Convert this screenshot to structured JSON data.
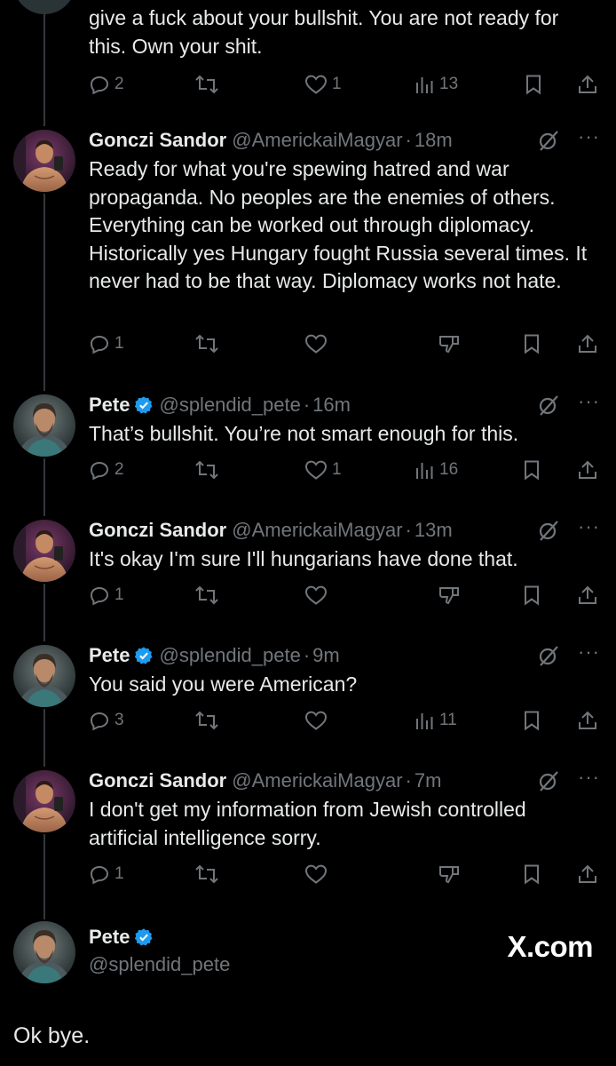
{
  "colors": {
    "background": "#000000",
    "text_primary": "#e7e9ea",
    "text_secondary": "#71767b",
    "verified_blue": "#1d9bf0",
    "thread_line": "#333639"
  },
  "top_partial": {
    "text": "give a fuck about your bullshit. You are not ready for this. Own your shit.",
    "replies": "2",
    "likes": "1",
    "views": "13"
  },
  "tweets": [
    {
      "name": "Gonczi Sandor",
      "verified": false,
      "handle": "@AmerickaiMagyar",
      "dot": "·",
      "time": "18m",
      "text": "Ready for what you're spewing hatred and war propaganda. No peoples are the enemies of others. Everything can be worked out through diplomacy. Historically yes Hungary fought Russia several times. It never had to be that way. Diplomacy works not hate.",
      "replies": "1",
      "likes": "",
      "views": "",
      "downvote": true
    },
    {
      "name": "Pete",
      "verified": true,
      "handle": "@splendid_pete",
      "dot": "·",
      "time": "16m",
      "text": "That’s bullshit. You’re not smart enough for this.",
      "replies": "2",
      "likes": "1",
      "views": "16",
      "downvote": false
    },
    {
      "name": "Gonczi Sandor",
      "verified": false,
      "handle": "@AmerickaiMagyar",
      "dot": "·",
      "time": "13m",
      "text": "It's okay I'm sure I'll hungarians have done that.",
      "replies": "1",
      "likes": "",
      "views": "",
      "downvote": true
    },
    {
      "name": "Pete",
      "verified": true,
      "handle": "@splendid_pete",
      "dot": "·",
      "time": "9m",
      "text": "You said you were American?",
      "replies": "3",
      "likes": "",
      "views": "11",
      "downvote": false
    },
    {
      "name": "Gonczi Sandor",
      "verified": false,
      "handle": "@AmerickaiMagyar",
      "dot": "·",
      "time": "7m",
      "text": "I don't get my information from Jewish controlled artificial intelligence sorry.",
      "replies": "1",
      "likes": "",
      "views": "",
      "downvote": true
    }
  ],
  "final_tweet": {
    "name": "Pete",
    "handle": "@splendid_pete",
    "text": "Ok bye.",
    "watermark": "X.com"
  },
  "icons": {
    "reply": "reply-icon",
    "repost": "repost-icon",
    "like": "like-icon",
    "views": "views-icon",
    "downvote": "downvote-icon",
    "bookmark": "bookmark-icon",
    "share": "share-icon",
    "grok": "grok-icon",
    "more": "more-icon",
    "verified": "verified-badge-icon"
  }
}
